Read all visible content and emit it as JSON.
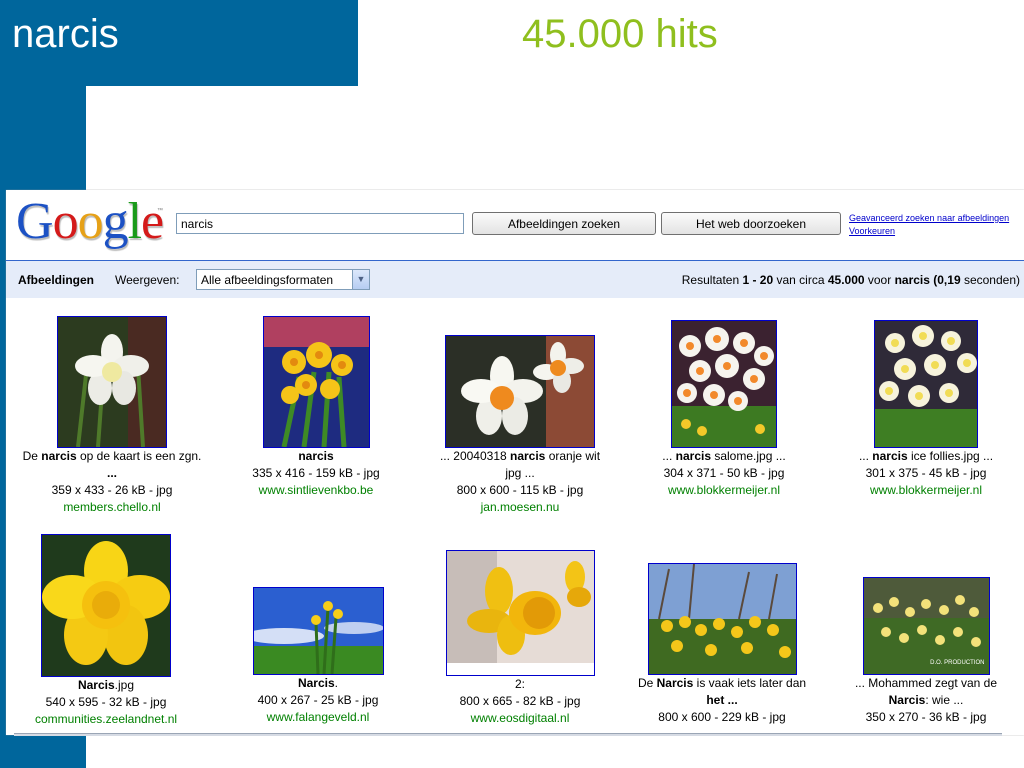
{
  "slide": {
    "title": "narcis",
    "hits": "45.000 hits"
  },
  "google": {
    "logo": [
      "G",
      "o",
      "o",
      "g",
      "l",
      "e"
    ],
    "logo_colors": [
      "#1c51c4",
      "#d41a1a",
      "#e6a118",
      "#1c51c4",
      "#1a9a1a",
      "#d41a1a"
    ],
    "search_value": "narcis",
    "buttons": {
      "images": "Afbeeldingen zoeken",
      "web": "Het web doorzoeken"
    },
    "links": {
      "advanced": "Geavanceerd zoeken naar afbeeldingen",
      "prefs": "Voorkeuren"
    }
  },
  "bar": {
    "label": "Afbeeldingen",
    "show_label": "Weergeven:",
    "filter_value": "Alle afbeeldingsformaten",
    "results_prefix": "Resultaten ",
    "results_range": "1 - 20",
    "results_mid": " van circa ",
    "results_total": "45.000",
    "results_for": " voor ",
    "results_query": "narcis",
    "results_time": "(0,19",
    "results_suffix": " seconden)"
  },
  "results": [
    {
      "caption_pre": "De ",
      "caption_bold": "narcis",
      "caption_post": " op de kaart is een zgn. ",
      "caption_line2": "...",
      "dims": "359 x 433 - 26 kB - jpg",
      "site": "members.chello.nl"
    },
    {
      "caption_pre": "",
      "caption_bold": "narcis",
      "caption_post": "",
      "caption_line2": "",
      "dims": "335 x 416 - 159 kB - jpg",
      "site": "www.sintlievenkbo.be"
    },
    {
      "caption_pre": "... 20040318 ",
      "caption_bold": "narcis",
      "caption_post": " oranje wit ",
      "caption_line2": "jpg ...",
      "dims": "800 x 600 - 115 kB - jpg",
      "site": "jan.moesen.nu"
    },
    {
      "caption_pre": "... ",
      "caption_bold": "narcis",
      "caption_post": " salome.jpg ...",
      "caption_line2": "",
      "dims": "304 x 371 - 50 kB - jpg",
      "site": "www.blokkermeijer.nl"
    },
    {
      "caption_pre": "... ",
      "caption_bold": "narcis",
      "caption_post": " ice follies.jpg ...",
      "caption_line2": "",
      "dims": "301 x 375 - 45 kB - jpg",
      "site": "www.blokkermeijer.nl"
    },
    {
      "caption_pre": "",
      "caption_bold": "Narcis",
      "caption_post": ".jpg",
      "caption_line2": "",
      "dims": "540 x 595 - 32 kB - jpg",
      "site": "communities.zeelandnet.nl"
    },
    {
      "caption_pre": "",
      "caption_bold": "Narcis",
      "caption_post": ".",
      "caption_line2": "",
      "dims": "400 x 267 - 25 kB - jpg",
      "site": "www.falangeveld.nl"
    },
    {
      "caption_pre": "2:",
      "caption_bold": "",
      "caption_post": "",
      "caption_line2": "",
      "dims": "800 x 665 - 82 kB - jpg",
      "site": "www.eosdigitaal.nl"
    },
    {
      "caption_pre": "De ",
      "caption_bold": "Narcis",
      "caption_post": " is vaak iets later dan ",
      "caption_line2": "het ...",
      "dims": "800 x 600 - 229 kB - jpg",
      "site": ""
    },
    {
      "caption_pre": "... Mohammed zegt van de ",
      "caption_bold": "",
      "caption_post": "",
      "caption_line2": "Narcis: wie ...",
      "dims": "350 x 270 - 36 kB - jpg",
      "site": ""
    }
  ],
  "watermark": "D.O. PRODUCTION"
}
